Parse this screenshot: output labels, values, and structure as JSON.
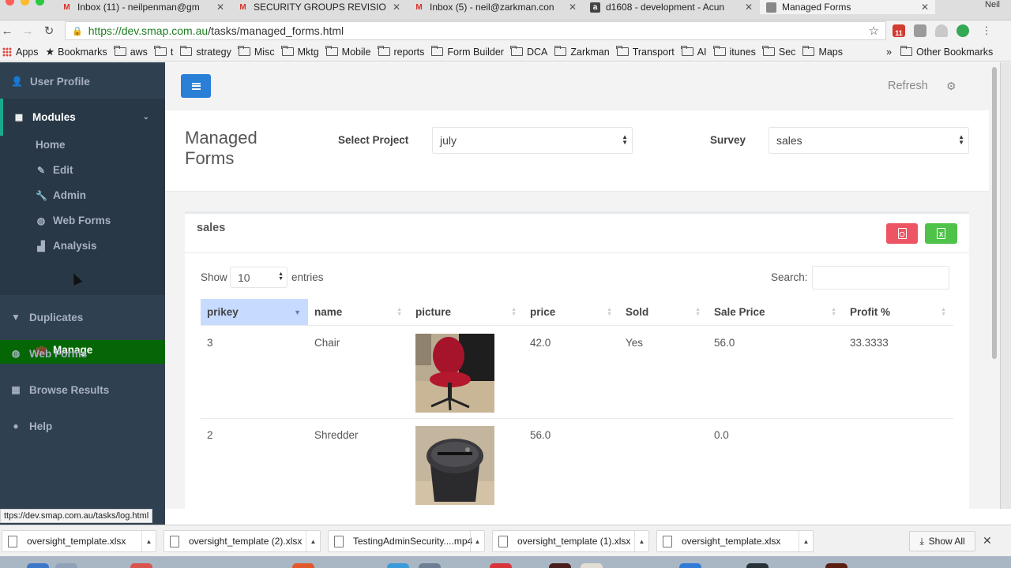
{
  "browser": {
    "tabs": [
      {
        "title": "Inbox (11) - neilpenman@gm",
        "favicon": "gmail-icon",
        "active": false
      },
      {
        "title": "SECURITY GROUPS REVISIO",
        "favicon": "gmail-icon",
        "active": false
      },
      {
        "title": "Inbox (5) - neil@zarkman.con",
        "favicon": "gmail-icon",
        "active": false
      },
      {
        "title": "d1608 - development - Acun",
        "favicon": "acunote-icon",
        "active": false
      },
      {
        "title": "Managed Forms",
        "favicon": "smap-icon",
        "active": true
      }
    ],
    "user": "Neil",
    "url_scheme_host": "https://dev.smap.com.au",
    "url_path": "/tasks/managed_forms.html",
    "bookmarks": [
      {
        "label": "Apps",
        "icon": "apps-icon"
      },
      {
        "label": "Bookmarks",
        "icon": "star-icon"
      },
      {
        "label": "aws",
        "icon": "folder-icon"
      },
      {
        "label": "t",
        "icon": "folder-icon"
      },
      {
        "label": "strategy",
        "icon": "folder-icon"
      },
      {
        "label": "Misc",
        "icon": "folder-icon"
      },
      {
        "label": "Mktg",
        "icon": "folder-icon"
      },
      {
        "label": "Mobile",
        "icon": "folder-icon"
      },
      {
        "label": "reports",
        "icon": "folder-icon"
      },
      {
        "label": "Form Builder",
        "icon": "folder-icon"
      },
      {
        "label": "DCA",
        "icon": "folder-icon"
      },
      {
        "label": "Zarkman",
        "icon": "folder-icon"
      },
      {
        "label": "Transport",
        "icon": "folder-icon"
      },
      {
        "label": "AI",
        "icon": "folder-icon"
      },
      {
        "label": "itunes",
        "icon": "folder-icon"
      },
      {
        "label": "Sec",
        "icon": "folder-icon"
      },
      {
        "label": "Maps",
        "icon": "folder-icon"
      }
    ],
    "bookmarks_overflow": "»",
    "other_bookmarks": "Other Bookmarks",
    "extension_badge": "11"
  },
  "sidebar": {
    "user_profile": "User Profile",
    "modules": "Modules",
    "submenu": [
      {
        "label": "Home",
        "icon": ""
      },
      {
        "label": "Edit",
        "icon": "edit-icon"
      },
      {
        "label": "Admin",
        "icon": "wrench-icon"
      },
      {
        "label": "Web Forms",
        "icon": "globe-icon"
      },
      {
        "label": "Analysis",
        "icon": "bar-chart-icon"
      },
      {
        "label": "Manage",
        "icon": "briefcase-icon"
      }
    ],
    "duplicates": "Duplicates",
    "web_forms": "Web Forms",
    "browse_results": "Browse Results",
    "help": "Help"
  },
  "topbar": {
    "refresh": "Refresh"
  },
  "header": {
    "title": "Managed Forms",
    "select_project_label": "Select Project",
    "project": "july",
    "survey_label": "Survey",
    "survey": "sales"
  },
  "panel": {
    "title": "sales",
    "show": "Show",
    "page_length": "10",
    "entries": "entries",
    "search_label": "Search:",
    "columns": [
      "prikey",
      "name",
      "picture",
      "price",
      "Sold",
      "Sale Price",
      "Profit %"
    ],
    "sorted_column": "prikey",
    "rows": [
      {
        "prikey": "3",
        "name": "Chair",
        "picture": "chair-photo",
        "price": "42.0",
        "sold": "Yes",
        "sale_price": "56.0",
        "profit": "33.3333"
      },
      {
        "prikey": "2",
        "name": "Shredder",
        "picture": "shredder-photo",
        "price": "56.0",
        "sold": "",
        "sale_price": "0.0",
        "profit": ""
      }
    ]
  },
  "status_url": "ttps://dev.smap.com.au/tasks/log.html",
  "downloads": {
    "items": [
      "oversight_template.xlsx",
      "oversight_template (2).xlsx",
      "TestingAdminSecurity....mp4",
      "oversight_template (1).xlsx",
      "oversight_template.xlsx"
    ],
    "show_all": "Show All"
  },
  "colors": {
    "sidebar_bg": "#2f4050",
    "menu_button": "#2a7fd6",
    "active_item": "#056605",
    "pdf_button": "#ed5565",
    "excel_button": "#4fc24a",
    "sorted_header": "#c6dbff"
  }
}
